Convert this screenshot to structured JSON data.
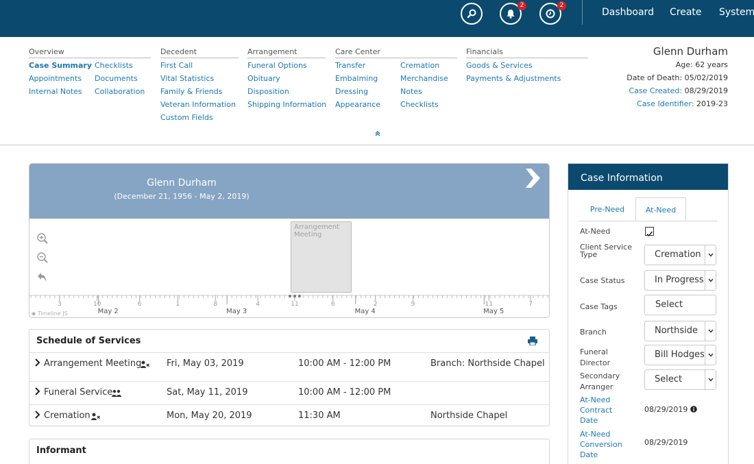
{
  "topbar": {
    "search_icon": "search-icon",
    "notifications": {
      "icon": "bell-icon",
      "badge": "2"
    },
    "reminders": {
      "icon": "clock-icon",
      "badge": "2"
    },
    "nav": [
      "Dashboard",
      "Create",
      "System"
    ]
  },
  "menu": {
    "overview": {
      "heading": "Overview",
      "links": [
        "Case Summary",
        "Checklists",
        "Appointments",
        "Documents",
        "Internal Notes",
        "Collaboration"
      ]
    },
    "decedent": {
      "heading": "Decedent",
      "links": [
        "First Call",
        "Vital Statistics",
        "Family & Friends",
        "Veteran Information",
        "Custom Fields"
      ]
    },
    "arrangement": {
      "heading": "Arrangement",
      "links": [
        "Funeral Options",
        "Obituary",
        "Disposition",
        "Shipping Information"
      ]
    },
    "care_center": {
      "heading": "Care Center",
      "links": [
        "Transfer",
        "Cremation",
        "Embalming",
        "Merchandise",
        "Dressing",
        "Notes",
        "Appearance",
        "Checklists"
      ]
    },
    "financials": {
      "heading": "Financials",
      "links": [
        "Goods & Services",
        "Payments & Adjustments"
      ]
    },
    "collapse_icon": "double-chevron-up-icon"
  },
  "case_summary": {
    "name": "Glenn Durham",
    "age": "Age: 62 years",
    "date_of_death": "Date of Death: 05/02/2019",
    "case_created_label": "Case Created:",
    "case_created": "08/29/2019",
    "case_identifier_label": "Case Identifier:",
    "case_identifier": "2019-23"
  },
  "timeline": {
    "name": "Glenn Durham",
    "dates": "(December 21, 1956 - May 2, 2019)",
    "event": "Arrangement Meeting",
    "credit": "Timeline JS",
    "hour_ticks": [
      "3",
      "10",
      "6",
      "1",
      "8",
      "4",
      "11",
      "6",
      "2",
      "9",
      "11",
      "7"
    ],
    "day_labels": [
      "May 2",
      "May 3",
      "May 4",
      "May 5"
    ]
  },
  "schedule": {
    "title": "Schedule of Services",
    "rows": [
      {
        "name": "Arrangement Meeting",
        "icon": "user-x-icon",
        "date": "Fri, May 03, 2019",
        "time": "10:00 AM - 12:00 PM",
        "location": "Branch: Northside Chapel"
      },
      {
        "name": "Funeral Service",
        "icon": "users-icon",
        "date": "Sat, May 11, 2019",
        "time": "10:00 AM - 12:00 PM",
        "location": ""
      },
      {
        "name": "Cremation",
        "icon": "user-x-icon",
        "date": "Mon, May 20, 2019",
        "time": "11:30 AM",
        "location": "Northside Chapel"
      }
    ]
  },
  "informant": {
    "title": "Informant"
  },
  "case_info": {
    "title": "Case Information",
    "tabs": [
      "Pre-Need",
      "At-Need"
    ],
    "active_tab": "At-Need",
    "at_need_label": "At-Need",
    "at_need_checked": true,
    "client_service_type_label": "Client Service Type",
    "client_service_type": "Cremation",
    "case_status_label": "Case Status",
    "case_status": "In Progress",
    "case_tags_label": "Case Tags",
    "case_tags": "Select",
    "branch_label": "Branch",
    "branch": "Northside",
    "funeral_director_label": "Funeral Director",
    "funeral_director": "Bill Hodges",
    "secondary_arranger_label": "Secondary Arranger",
    "secondary_arranger": "Select",
    "contract_date_label": "At-Need Contract Date",
    "contract_date": "08/29/2019",
    "conversion_date_label": "At-Need Conversion Date",
    "conversion_date": "08/29/2019"
  },
  "colors": {
    "brand": "#0b4a6e",
    "link": "#1b78b3",
    "timeline_header": "#86a4c3",
    "badge": "#d6202a"
  }
}
